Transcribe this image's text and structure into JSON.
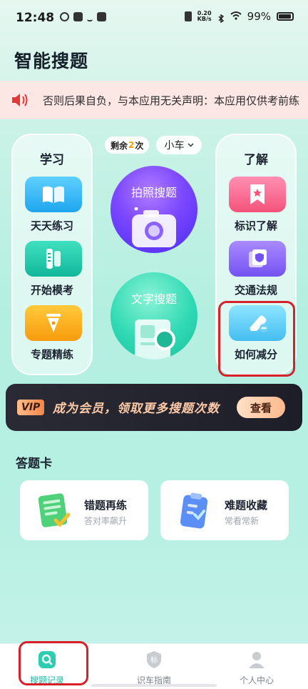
{
  "status_bar": {
    "time": "12:48",
    "net_speed": "0.20",
    "net_unit": "KB/s",
    "battery": "99%"
  },
  "header": {
    "title": "智能搜题"
  },
  "notice": {
    "text": "否则后果自负，与本应用无关声明：本应用仅供考前练",
    "icon": "speaker-icon",
    "accent": "#e23a3a"
  },
  "study": {
    "title": "学习",
    "items": [
      {
        "label": "天天练习",
        "icon": "book-icon"
      },
      {
        "label": "开始模考",
        "icon": "pencil-ruler-icon"
      },
      {
        "label": "专题精练",
        "icon": "pen-nib-icon"
      }
    ]
  },
  "learn": {
    "title": "了解",
    "items": [
      {
        "label": "标识了解",
        "icon": "bookmark-star-icon"
      },
      {
        "label": "交通法规",
        "icon": "shield-doc-icon"
      },
      {
        "label": "如何减分",
        "icon": "eraser-icon"
      }
    ]
  },
  "center": {
    "remain_prefix": "剩余",
    "remain_count": "2",
    "remain_suffix": "次",
    "vehicle": "小车",
    "photo_search": "拍照搜题",
    "text_search": "文字搜题"
  },
  "vip": {
    "tag": "VIP",
    "text": "成为会员，领取更多搜题次数",
    "button": "查看"
  },
  "answer_card": {
    "title": "答题卡",
    "cards": [
      {
        "title": "错题再练",
        "subtitle": "答对率飙升",
        "icon": "notebook-check-icon"
      },
      {
        "title": "难题收藏",
        "subtitle": "常看常新",
        "icon": "clipboard-check-icon"
      }
    ]
  },
  "bottom_nav": [
    {
      "label": "搜题记录",
      "icon": "search-record-icon",
      "active": true
    },
    {
      "label": "识车指南",
      "icon": "sign-badge-icon",
      "active": false
    },
    {
      "label": "个人中心",
      "icon": "user-icon",
      "active": false
    }
  ],
  "colors": {
    "primary": "#18b9a0",
    "highlight": "#d7202a"
  }
}
